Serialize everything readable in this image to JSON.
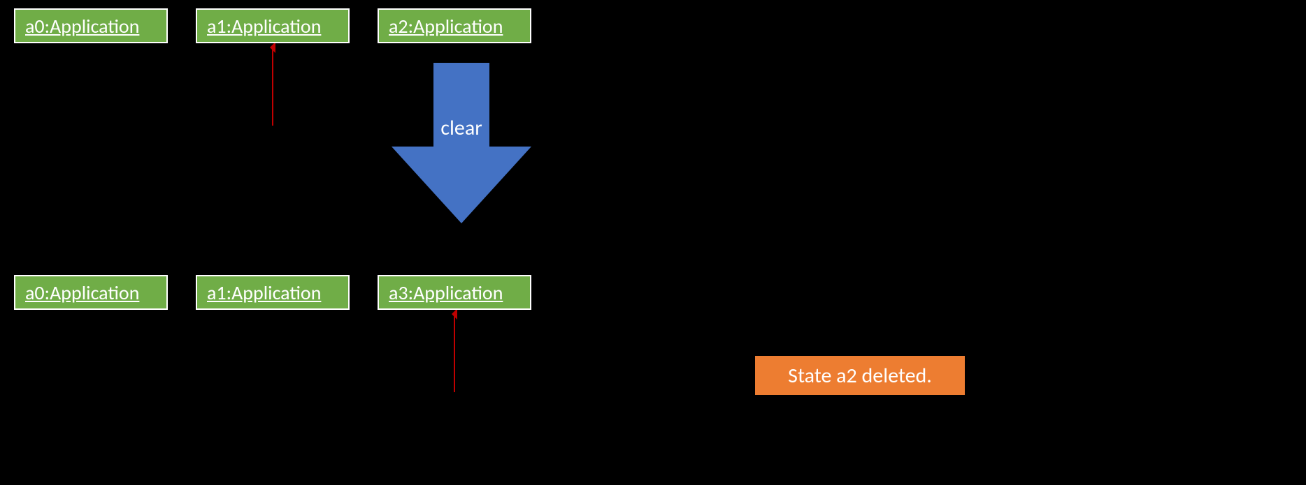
{
  "topRow": {
    "box0": "a0:Application",
    "box1": "a1:Application",
    "box2": "a2:Application"
  },
  "bottomRow": {
    "box0": "a0:Application",
    "box1": "a1:Application",
    "box2": "a3:Application"
  },
  "arrowLabel": "clear",
  "statusMessage": "State a2 deleted.",
  "colors": {
    "boxGreen": "#70AD47",
    "arrowBlue": "#4472C4",
    "statusOrange": "#ED7D31",
    "thinArrowRed": "#C00000",
    "white": "#FFFFFF"
  }
}
